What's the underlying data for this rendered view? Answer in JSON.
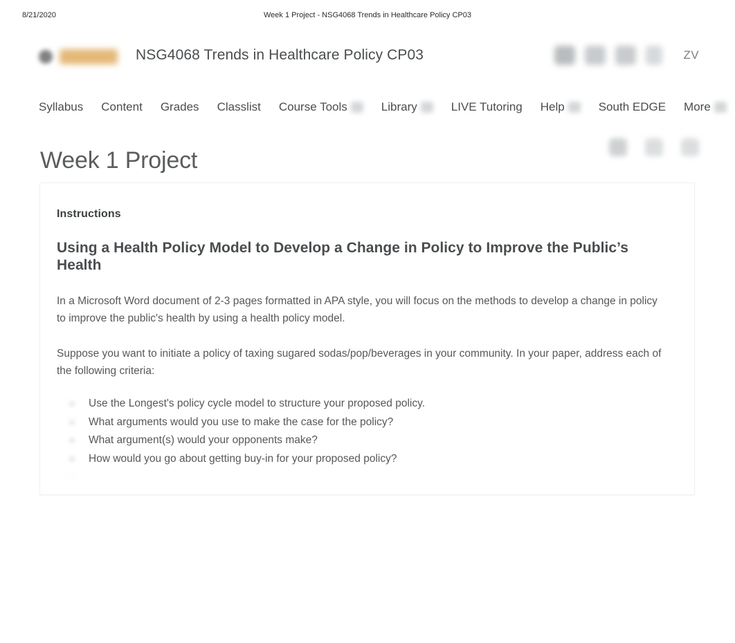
{
  "print_header": {
    "date": "8/21/2020",
    "title": "Week 1 Project - NSG4068 Trends in Healthcare Policy CP03"
  },
  "topbar": {
    "logo_icon": "institution-logo-icon",
    "course_title": "NSG4068 Trends in Healthcare Policy CP03",
    "icons": [
      {
        "name": "messages-icon",
        "label": ""
      },
      {
        "name": "subscriptions-icon",
        "label": ""
      },
      {
        "name": "notifications-icon",
        "label": ""
      },
      {
        "name": "profile-icon",
        "label": ""
      }
    ],
    "user_initials": "ZV"
  },
  "nav": {
    "items": [
      {
        "label": "Syllabus",
        "has_caret": false
      },
      {
        "label": "Content",
        "has_caret": false
      },
      {
        "label": "Grades",
        "has_caret": false
      },
      {
        "label": "Classlist",
        "has_caret": false
      },
      {
        "label": "Course Tools",
        "has_caret": true
      },
      {
        "label": "Library",
        "has_caret": true
      },
      {
        "label": "LIVE Tutoring",
        "has_caret": false
      },
      {
        "label": "Help",
        "has_caret": true
      },
      {
        "label": "South EDGE",
        "has_caret": false
      },
      {
        "label": "More",
        "has_caret": true
      }
    ]
  },
  "page": {
    "title": "Week 1 Project",
    "actions": [
      {
        "name": "print-icon"
      },
      {
        "name": "settings-icon"
      },
      {
        "name": "more-options-icon"
      }
    ]
  },
  "card": {
    "instructions_label": "Instructions",
    "doc_heading": "Using a Health Policy Model to Develop a Change in Policy to Improve the Public’s Health",
    "paragraphs": [
      "In a Microsoft Word document of 2-3 pages formatted in APA style, you will focus on the methods to develop a change in policy to improve the public's health by using a health policy model.",
      "Suppose you want to initiate a policy of taxing sugared sodas/pop/beverages in your community. In your paper, address each of the following criteria:"
    ],
    "criteria": [
      "Use the Longest's policy cycle model to structure your proposed policy.",
      "What arguments would you use to make the case for the policy?",
      "What argument(s) would your opponents make?",
      "How would you go about getting buy-in for your proposed policy?",
      ""
    ]
  },
  "colors": {
    "brand_accent": "#e4b878",
    "text_primary": "#4a4d4f",
    "text_body": "#55585a",
    "page_background": "#ffffff"
  }
}
